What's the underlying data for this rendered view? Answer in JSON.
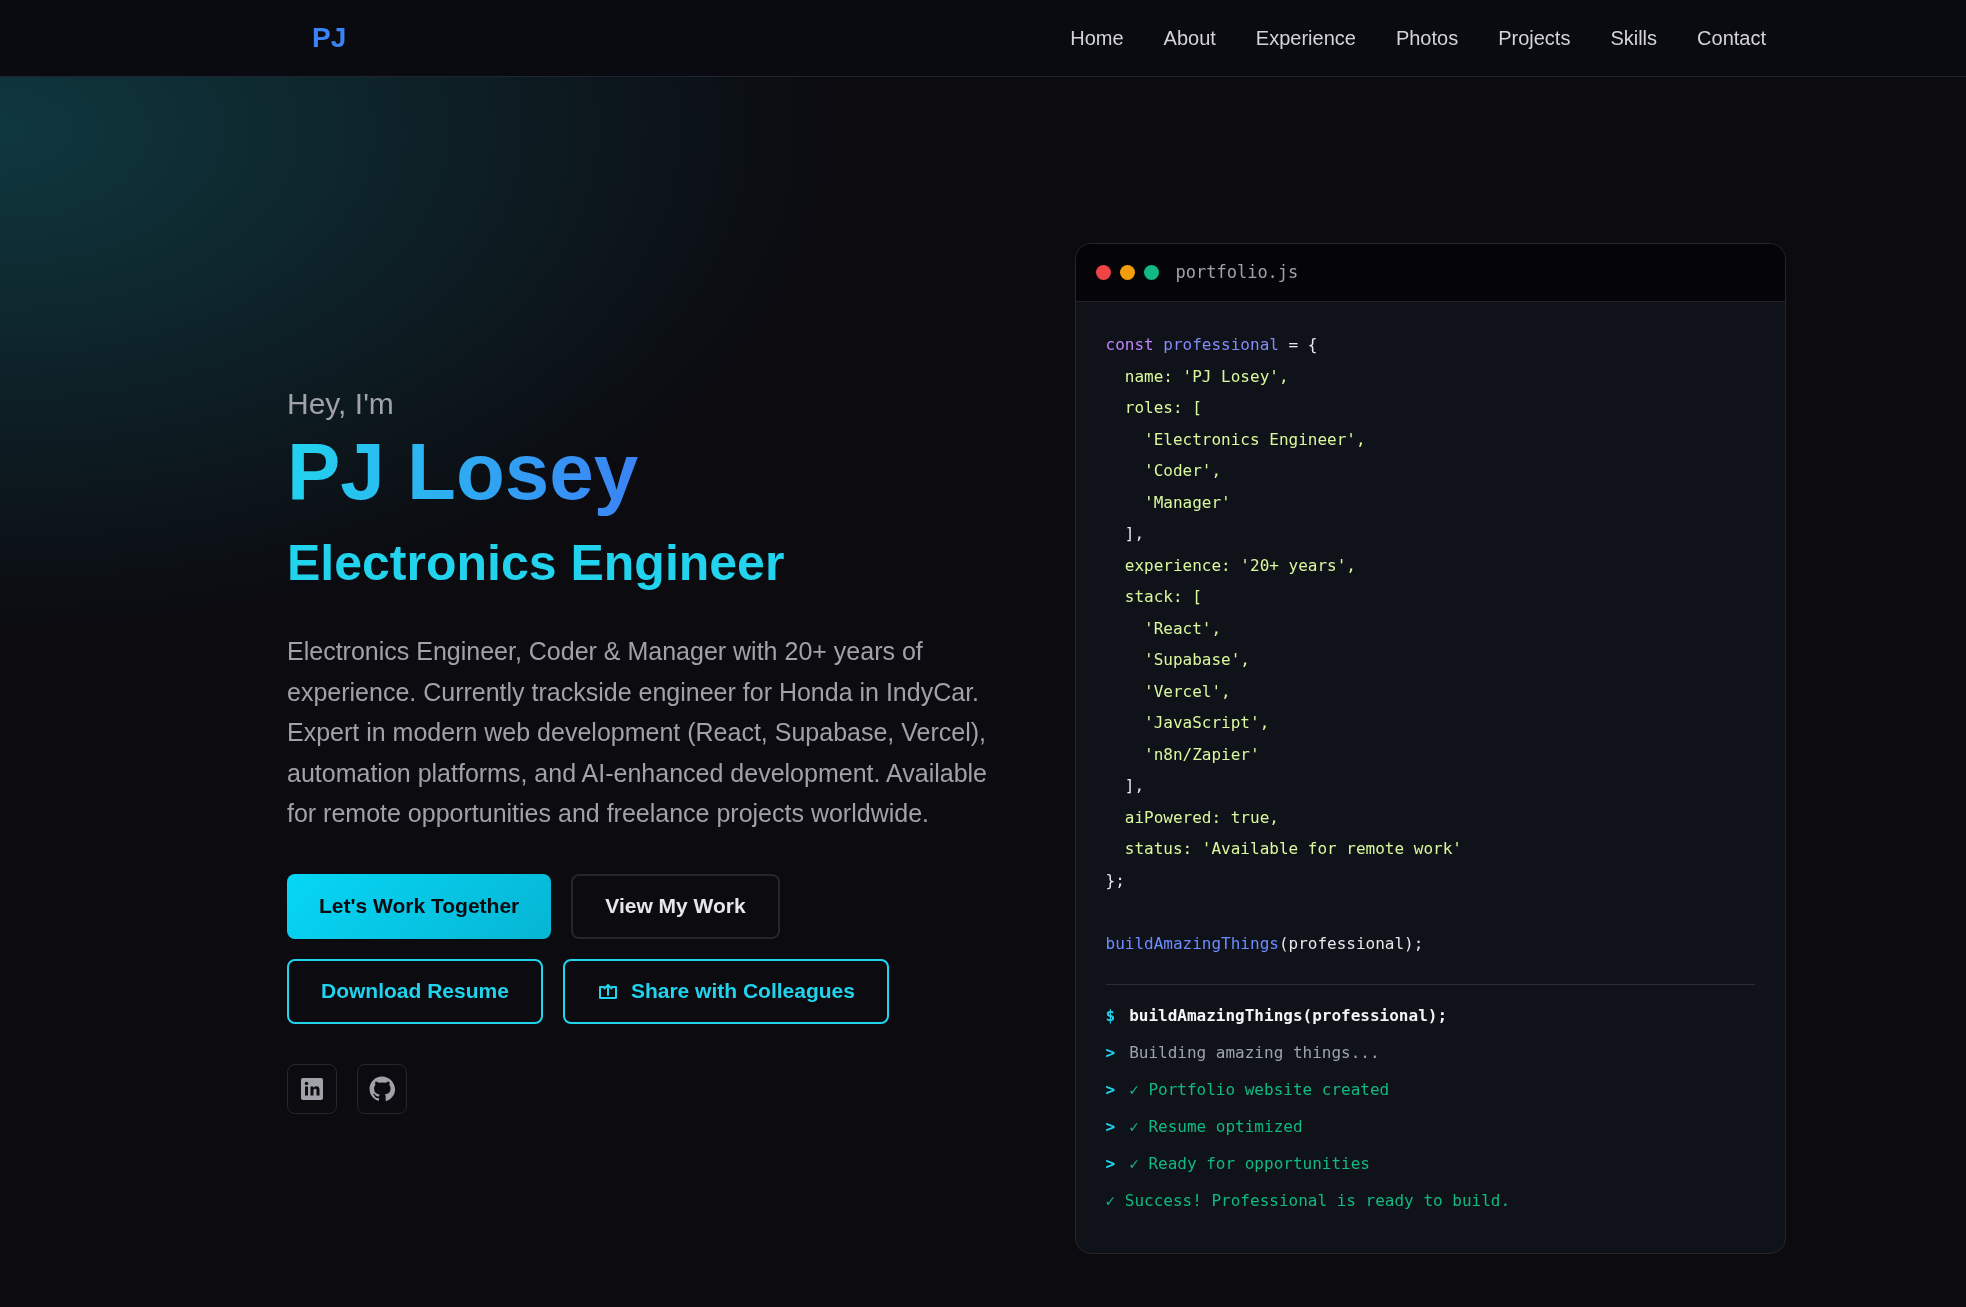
{
  "nav": {
    "logo": "PJ",
    "links": [
      {
        "label": "Home"
      },
      {
        "label": "About"
      },
      {
        "label": "Experience"
      },
      {
        "label": "Photos"
      },
      {
        "label": "Projects"
      },
      {
        "label": "Skills"
      },
      {
        "label": "Contact"
      }
    ]
  },
  "hero": {
    "greeting": "Hey, I'm",
    "name": "PJ Losey",
    "role": "Electronics Engineer",
    "bio": "Electronics Engineer, Coder & Manager with 20+ years of experience. Currently trackside engineer for Honda in IndyCar. Expert in modern web development (React, Supabase, Vercel), automation platforms, and AI-enhanced development. Available for remote opportunities and freelance projects worldwide.",
    "buttons": [
      {
        "label": "Let's Work Together",
        "kind": "primary"
      },
      {
        "label": "View My Work",
        "kind": "secondary"
      }
    ],
    "outline_buttons": [
      {
        "label": "Download Resume",
        "kind": "plain"
      },
      {
        "label": "Share with Colleagues",
        "kind": "share"
      }
    ],
    "socials": [
      {
        "kind": "linkedin"
      },
      {
        "kind": "github"
      }
    ]
  },
  "code_window": {
    "filename": "portfolio.js",
    "lines": [
      [
        {
          "kind": "keyword",
          "text": "const "
        },
        {
          "kind": "ident",
          "text": "professional"
        },
        {
          "kind": "plain",
          "text": " = {"
        }
      ],
      [
        {
          "kind": "prop",
          "text": "  name: 'PJ Losey',"
        }
      ],
      [
        {
          "kind": "prop",
          "text": "  roles: ["
        }
      ],
      [
        {
          "kind": "prop",
          "text": "    'Electronics Engineer',"
        }
      ],
      [
        {
          "kind": "prop",
          "text": "    'Coder',"
        }
      ],
      [
        {
          "kind": "prop",
          "text": "    'Manager'"
        }
      ],
      [
        {
          "kind": "plain",
          "text": "  ],"
        }
      ],
      [
        {
          "kind": "prop",
          "text": "  experience: '20+ years',"
        }
      ],
      [
        {
          "kind": "prop",
          "text": "  stack: ["
        }
      ],
      [
        {
          "kind": "prop",
          "text": "    'React',"
        }
      ],
      [
        {
          "kind": "prop",
          "text": "    'Supabase',"
        }
      ],
      [
        {
          "kind": "prop",
          "text": "    'Vercel',"
        }
      ],
      [
        {
          "kind": "prop",
          "text": "    'JavaScript',"
        }
      ],
      [
        {
          "kind": "prop",
          "text": "    'n8n/Zapier'"
        }
      ],
      [
        {
          "kind": "plain",
          "text": "  ],"
        }
      ],
      [
        {
          "kind": "prop",
          "text": "  aiPowered: true,"
        }
      ],
      [
        {
          "kind": "prop",
          "text": "  status: 'Available for remote work'"
        }
      ],
      [
        {
          "kind": "plain",
          "text": "};"
        }
      ]
    ],
    "call_lines": [
      [
        {
          "kind": "func",
          "text": "buildAmazingThings"
        },
        {
          "kind": "plain",
          "text": "(professional);"
        }
      ]
    ],
    "terminal": [
      {
        "prompt": "$",
        "text": "buildAmazingThings(professional);",
        "kind": "command"
      },
      {
        "prompt": ">",
        "text": "Building amazing things...",
        "kind": "info"
      },
      {
        "prompt": ">",
        "text": "✓ Portfolio website created",
        "kind": "success"
      },
      {
        "prompt": ">",
        "text": "✓ Resume optimized",
        "kind": "success"
      },
      {
        "prompt": ">",
        "text": "✓ Ready for opportunities",
        "kind": "success"
      },
      {
        "text": "✓ Success! Professional is ready to build.",
        "kind": "success"
      }
    ]
  }
}
